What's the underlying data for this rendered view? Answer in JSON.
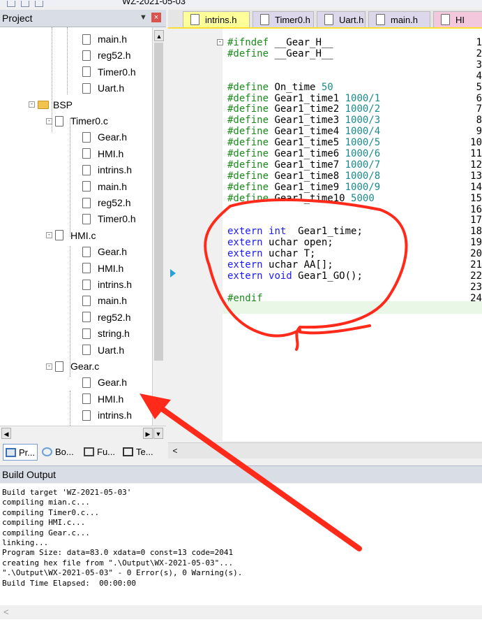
{
  "toolbar": {
    "target_text": "WZ-2021-05-03"
  },
  "project": {
    "title": "Project",
    "pin_icon": "pin-icon",
    "close_icon": "close-icon",
    "tree": [
      {
        "label": "main.h",
        "kind": "file",
        "depth": 3
      },
      {
        "label": "reg52.h",
        "kind": "file",
        "depth": 3
      },
      {
        "label": "Timer0.h",
        "kind": "file",
        "depth": 3
      },
      {
        "label": "Uart.h",
        "kind": "file",
        "depth": 3
      },
      {
        "label": "BSP",
        "kind": "folder",
        "depth": 1
      },
      {
        "label": "Timer0.c",
        "kind": "cfile",
        "depth": 2
      },
      {
        "label": "Gear.h",
        "kind": "file",
        "depth": 3
      },
      {
        "label": "HMI.h",
        "kind": "file",
        "depth": 3
      },
      {
        "label": "intrins.h",
        "kind": "file",
        "depth": 3
      },
      {
        "label": "main.h",
        "kind": "file",
        "depth": 3
      },
      {
        "label": "reg52.h",
        "kind": "file",
        "depth": 3
      },
      {
        "label": "Timer0.h",
        "kind": "file",
        "depth": 3
      },
      {
        "label": "HMI.c",
        "kind": "cfile",
        "depth": 2
      },
      {
        "label": "Gear.h",
        "kind": "file",
        "depth": 3
      },
      {
        "label": "HMI.h",
        "kind": "file",
        "depth": 3
      },
      {
        "label": "intrins.h",
        "kind": "file",
        "depth": 3
      },
      {
        "label": "main.h",
        "kind": "file",
        "depth": 3
      },
      {
        "label": "reg52.h",
        "kind": "file",
        "depth": 3
      },
      {
        "label": "string.h",
        "kind": "file",
        "depth": 3
      },
      {
        "label": "Uart.h",
        "kind": "file",
        "depth": 3
      },
      {
        "label": "Gear.c",
        "kind": "cfile",
        "depth": 2
      },
      {
        "label": "Gear.h",
        "kind": "file",
        "depth": 3
      },
      {
        "label": "HMI.h",
        "kind": "file",
        "depth": 3
      },
      {
        "label": "intrins.h",
        "kind": "file",
        "depth": 3
      }
    ],
    "bottom_tabs": [
      {
        "label": "Pr...",
        "icon": "project-icon"
      },
      {
        "label": "Bo...",
        "icon": "books-icon"
      },
      {
        "label": "Fu...",
        "icon": "functions-icon"
      },
      {
        "label": "Te...",
        "icon": "templates-icon"
      }
    ]
  },
  "editor": {
    "tabs": [
      {
        "label": "intrins.h",
        "active": true
      },
      {
        "label": "Timer0.h",
        "active": false
      },
      {
        "label": "Uart.h",
        "active": false
      },
      {
        "label": "main.h",
        "active": false
      },
      {
        "label": "HI",
        "active": false
      }
    ],
    "lines": [
      {
        "n": "1",
        "html": "<span class='pp'>#ifndef</span> __Gear_H__",
        "fold": "-"
      },
      {
        "n": "2",
        "html": "<span class='pp'>#define</span> __Gear_H__"
      },
      {
        "n": "3",
        "html": ""
      },
      {
        "n": "4",
        "html": ""
      },
      {
        "n": "5",
        "html": "<span class='pp'>#define</span> On_time <span class='num'>50</span>"
      },
      {
        "n": "6",
        "html": "<span class='pp'>#define</span> Gear1_time1 <span class='num'>1000/1</span>"
      },
      {
        "n": "7",
        "html": "<span class='pp'>#define</span> Gear1_time2 <span class='num'>1000/2</span>"
      },
      {
        "n": "8",
        "html": "<span class='pp'>#define</span> Gear1_time3 <span class='num'>1000/3</span>"
      },
      {
        "n": "9",
        "html": "<span class='pp'>#define</span> Gear1_time4 <span class='num'>1000/4</span>"
      },
      {
        "n": "10",
        "html": "<span class='pp'>#define</span> Gear1_time5 <span class='num'>1000/5</span>"
      },
      {
        "n": "11",
        "html": "<span class='pp'>#define</span> Gear1_time6 <span class='num'>1000/6</span>"
      },
      {
        "n": "12",
        "html": "<span class='pp'>#define</span> Gear1_time7 <span class='num'>1000/7</span>"
      },
      {
        "n": "13",
        "html": "<span class='pp'>#define</span> Gear1_time8 <span class='num'>1000/8</span>"
      },
      {
        "n": "14",
        "html": "<span class='pp'>#define</span> Gear1_time9 <span class='num'>1000/9</span>"
      },
      {
        "n": "15",
        "html": "<span class='pp'>#define</span> Gear1_time10 <span class='num'>5000</span>"
      },
      {
        "n": "16",
        "html": ""
      },
      {
        "n": "17",
        "html": ""
      },
      {
        "n": "18",
        "html": "<span class='kw'>extern</span> <span class='kw'>int</span>  Gear1_time;"
      },
      {
        "n": "19",
        "html": "<span class='kw'>extern</span> uchar open;"
      },
      {
        "n": "20",
        "html": "<span class='kw'>extern</span> uchar T;"
      },
      {
        "n": "21",
        "html": "<span class='kw'>extern</span> uchar AA[];"
      },
      {
        "n": "22",
        "html": "<span class='kw'>extern</span> <span class='kw'>void</span> Gear1_GO();"
      },
      {
        "n": "23",
        "html": ""
      },
      {
        "n": "24",
        "html": "<span class='pp'>#endif</span>"
      }
    ]
  },
  "build": {
    "title": "Build Output",
    "lines": [
      "Build target 'WZ-2021-05-03'",
      "compiling mian.c...",
      "compiling Timer0.c...",
      "compiling HMI.c...",
      "compiling Gear.c...",
      "linking...",
      "Program Size: data=83.0 xdata=0 const=13 code=2041",
      "creating hex file from \".\\Output\\WX-2021-05-03\"...",
      "\".\\Output\\WX-2021-05-03\" - 0 Error(s), 0 Warning(s).",
      "Build Time Elapsed:  00:00:00"
    ]
  },
  "colors": {
    "annotation": "#ff2a1a",
    "active_tab": "#ffff99",
    "tab_underline": "#ffde2e"
  }
}
